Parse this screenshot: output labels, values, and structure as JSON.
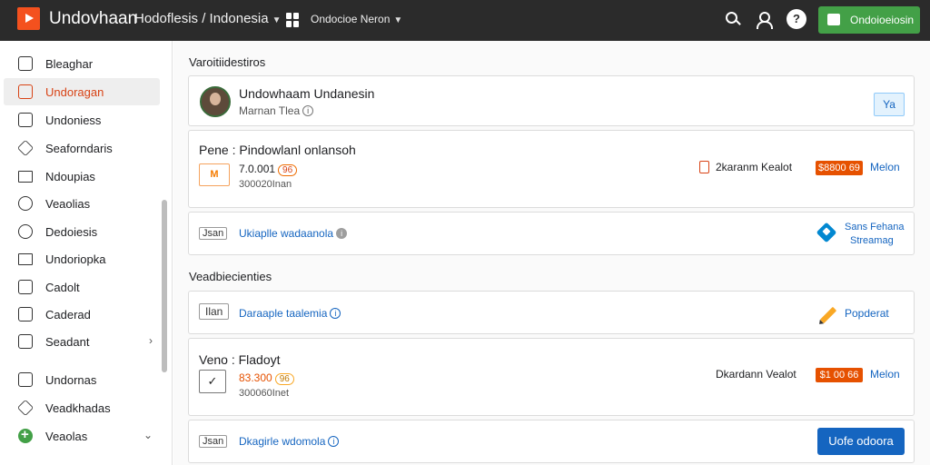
{
  "topbar": {
    "app_title": "Undovhaan",
    "breadcrumb": "Hodoflesis / Indonesia",
    "workspace": "Ondocioe Neron",
    "help_label": "?",
    "action_button": "Ondoioeiosin"
  },
  "sidebar": {
    "items": [
      {
        "label": "Bleaghar"
      },
      {
        "label": "Undoragan"
      },
      {
        "label": "Undoniess"
      },
      {
        "label": "Seaforndaris"
      },
      {
        "label": "Ndoupias"
      },
      {
        "label": "Veaolias"
      },
      {
        "label": "Dedoiesis"
      },
      {
        "label": "Undoriopka"
      },
      {
        "label": "Cadolt"
      },
      {
        "label": "Caderad"
      },
      {
        "label": "Seadant",
        "arrow": "›"
      },
      {
        "label": "Undornas"
      },
      {
        "label": "Veadkhadas"
      },
      {
        "label": "Veaolas",
        "arrow": "⌄"
      }
    ]
  },
  "main": {
    "section1_title": "Varoitiidestiros",
    "profile": {
      "name": "Undowhaam Undanesin",
      "subtitle": "Marnan Tlea",
      "version": "Ya"
    },
    "product1": {
      "title": "Pene :  Pindowlanl onlansoh",
      "icon_text": "M",
      "price": "7.0.001",
      "badge": "96",
      "date": "300020Inan",
      "vendor": "2karanm Kealot",
      "amount": "$8800 69",
      "link": "Melon"
    },
    "row1": {
      "code": "Jsan",
      "link": "Ukiaplle wadaanola",
      "side_text_1": "Sans Fehana",
      "side_text_2": "Streamag"
    },
    "section2_title": "Veadbiecienties",
    "row2": {
      "code": "Ilan",
      "link": "Daraaple taalemia",
      "side_link": "Popderat"
    },
    "product2": {
      "title": "Veno :  Fladoyt",
      "price": "83.300",
      "badge": "96",
      "date": "300060Inet",
      "vendor": "Dkardann Vealot",
      "amount": "$1 00 66",
      "link": "Melon"
    },
    "row3": {
      "code": "Jsan",
      "link": "Dkagirle wdomola",
      "button": "Uofe odoora"
    }
  }
}
